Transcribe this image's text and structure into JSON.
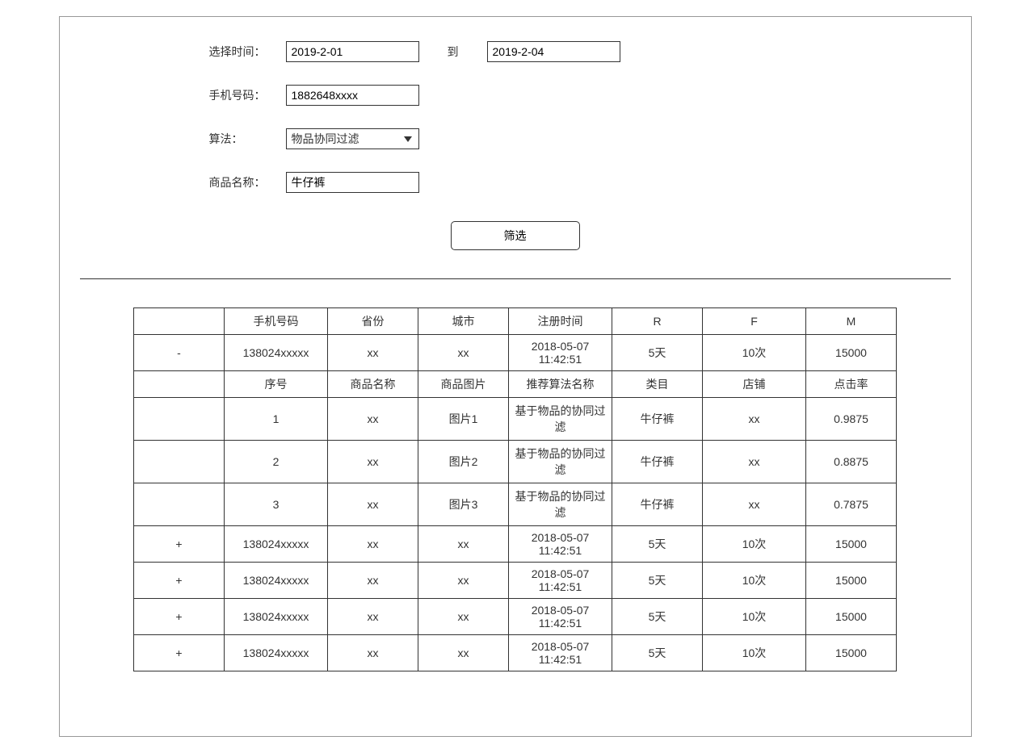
{
  "form": {
    "time_label": "选择时间：",
    "start_date": "2019-2-01",
    "to_label": "到",
    "end_date": "2019-2-04",
    "phone_label": "手机号码：",
    "phone_value": "1882648xxxx",
    "algorithm_label": "算法：",
    "algorithm_value": "物品协同过滤",
    "product_label": "商品名称：",
    "product_value": "牛仔裤",
    "filter_button": "筛选"
  },
  "table": {
    "header1": [
      "",
      "手机号码",
      "省份",
      "城市",
      "注册时间",
      "R",
      "F",
      "M"
    ],
    "expanded_row": [
      "-",
      "138024xxxxx",
      "xx",
      "xx",
      "2018-05-07 11:42:51",
      "5天",
      "10次",
      "15000"
    ],
    "header2": [
      "",
      "序号",
      "商品名称",
      "商品图片",
      "推荐算法名称",
      "类目",
      "店铺",
      "点击率"
    ],
    "detail_rows": [
      [
        "",
        "1",
        "xx",
        "图片1",
        "基于物品的协同过滤",
        "牛仔裤",
        "xx",
        "0.9875"
      ],
      [
        "",
        "2",
        "xx",
        "图片2",
        "基于物品的协同过滤",
        "牛仔裤",
        "xx",
        "0.8875"
      ],
      [
        "",
        "3",
        "xx",
        "图片3",
        "基于物品的协同过滤",
        "牛仔裤",
        "xx",
        "0.7875"
      ]
    ],
    "collapsed_rows": [
      [
        "+",
        "138024xxxxx",
        "xx",
        "xx",
        "2018-05-07 11:42:51",
        "5天",
        "10次",
        "15000"
      ],
      [
        "+",
        "138024xxxxx",
        "xx",
        "xx",
        "2018-05-07 11:42:51",
        "5天",
        "10次",
        "15000"
      ],
      [
        "+",
        "138024xxxxx",
        "xx",
        "xx",
        "2018-05-07 11:42:51",
        "5天",
        "10次",
        "15000"
      ],
      [
        "+",
        "138024xxxxx",
        "xx",
        "xx",
        "2018-05-07 11:42:51",
        "5天",
        "10次",
        "15000"
      ]
    ]
  }
}
